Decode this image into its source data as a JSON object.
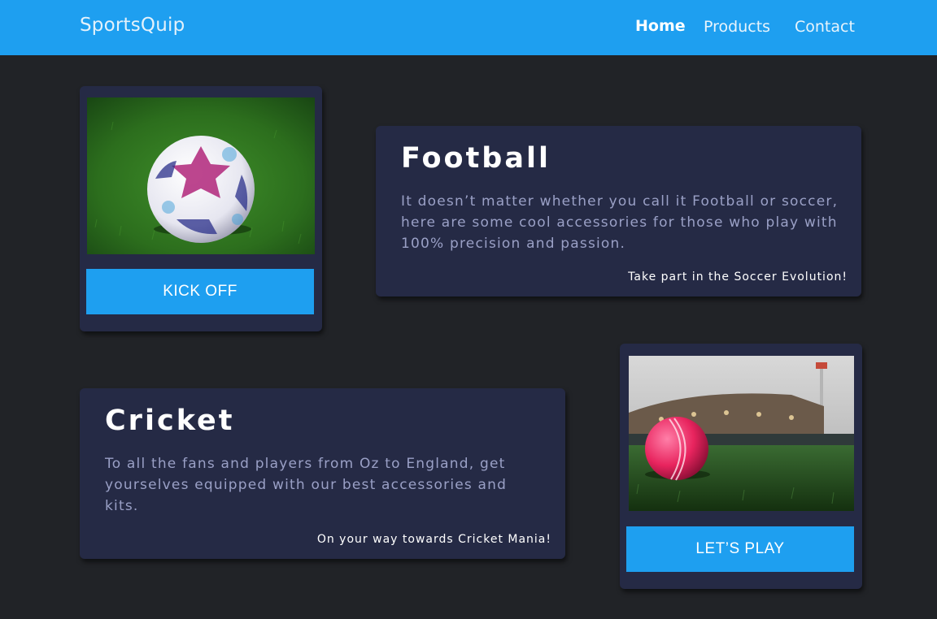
{
  "header": {
    "brand": "SportsQuip",
    "nav": {
      "home": "Home",
      "products": "Products",
      "contact": "Contact"
    }
  },
  "football": {
    "title": "Football",
    "description": "It doesn’t matter whether you call it Football or soccer, here are some cool accessories for those who play with 100% precision and passion.",
    "tagline": "Take part in the Soccer Evolution!",
    "button_label": "KICK OFF"
  },
  "cricket": {
    "title": "Cricket",
    "description": "To all the fans and players from Oz to England, get yourselves equipped with our best accessories and kits.",
    "tagline": "On your way towards Cricket Mania!",
    "button_label": "LET’S PLAY"
  },
  "colors": {
    "accent": "#1e9ff0",
    "background": "#212327",
    "card": "#252a45",
    "muted_text": "#9aa0c6"
  }
}
